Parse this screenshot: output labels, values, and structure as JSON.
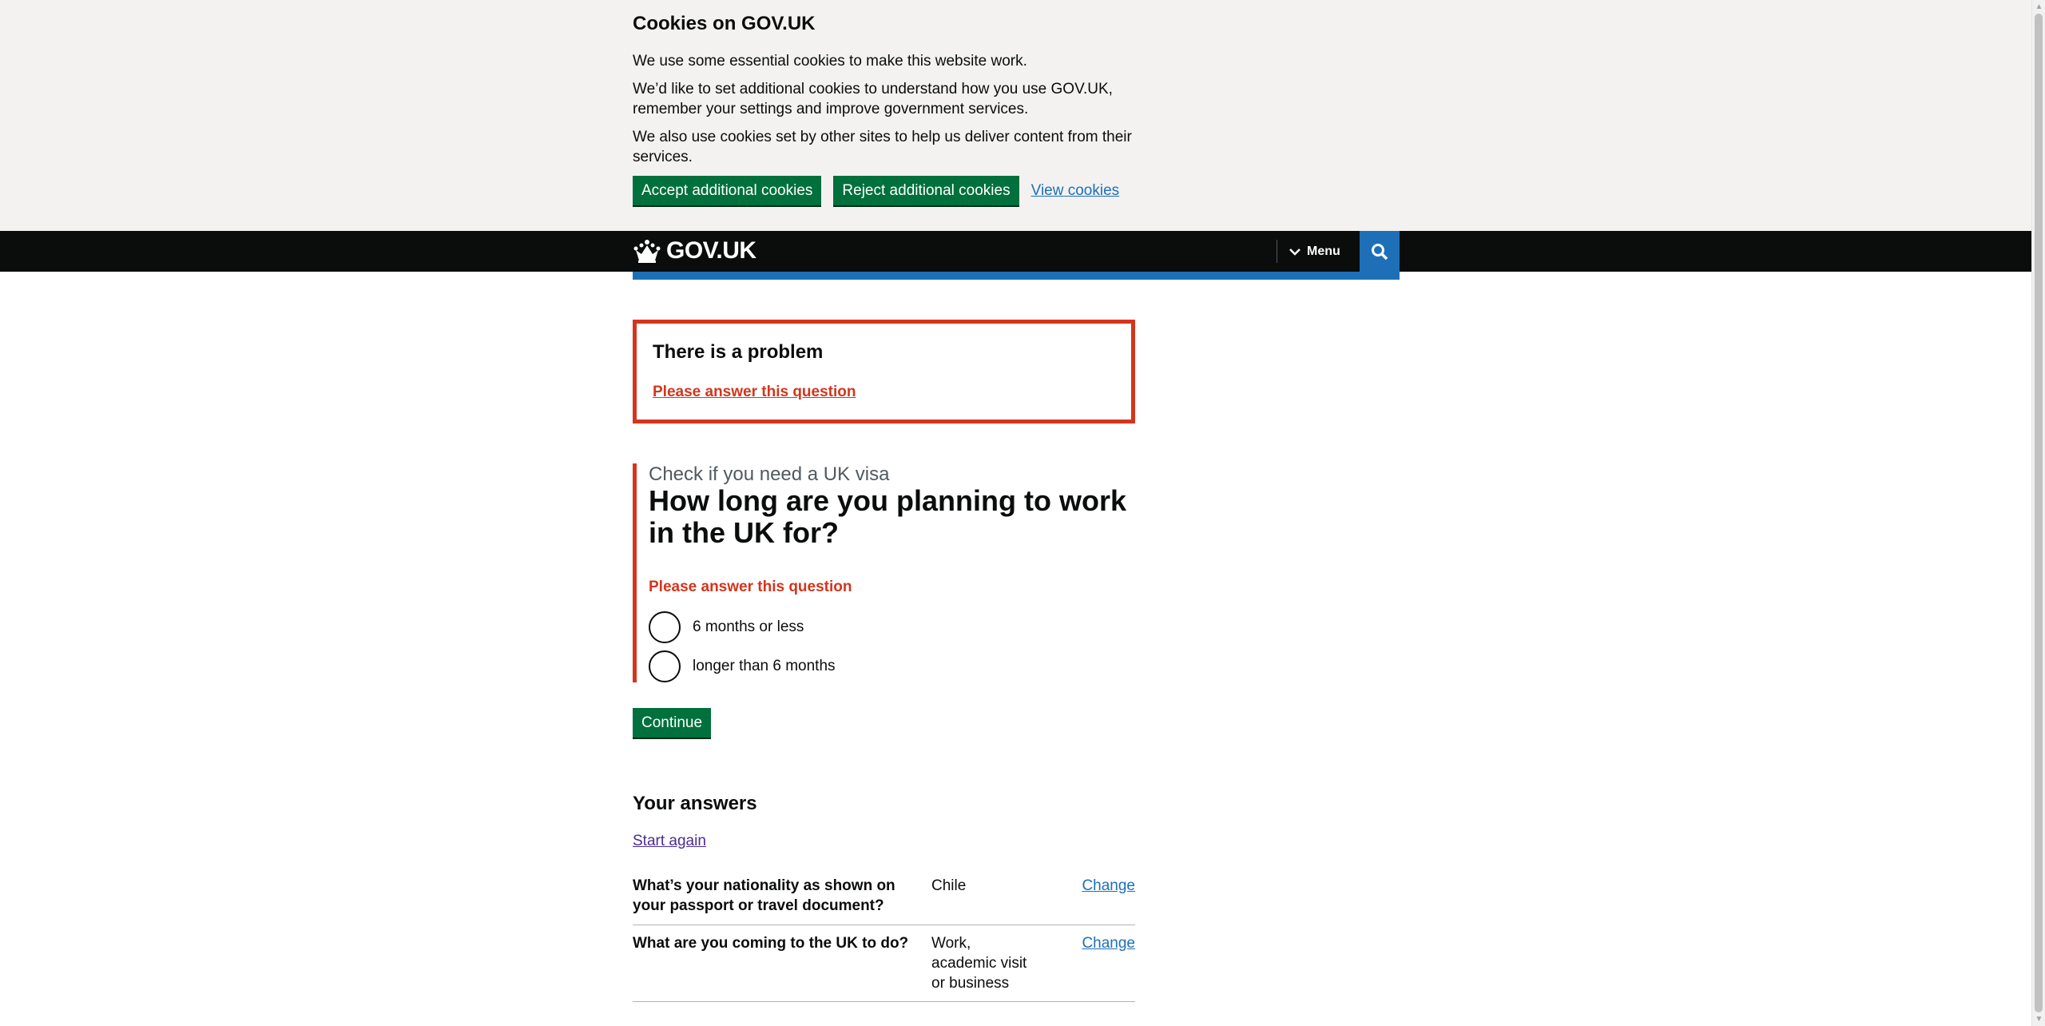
{
  "cookie_banner": {
    "title": "Cookies on GOV.UK",
    "paragraphs": [
      "We use some essential cookies to make this website work.",
      "We’d like to set additional cookies to understand how you use GOV.UK, remember your settings and improve government services.",
      "We also use cookies set by other sites to help us deliver content from their services."
    ],
    "accept_label": "Accept additional cookies",
    "reject_label": "Reject additional cookies",
    "view_label": "View cookies"
  },
  "header": {
    "logo_text": "GOV.UK",
    "menu_label": "Menu"
  },
  "error_summary": {
    "title": "There is a problem",
    "link": "Please answer this question"
  },
  "question": {
    "caption": "Check if you need a UK visa",
    "heading": "How long are you planning to work in the UK for?",
    "error": "Please answer this question",
    "options": [
      "6 months or less",
      "longer than 6 months"
    ]
  },
  "continue_label": "Continue",
  "answers": {
    "title": "Your answers",
    "start_again": "Start again",
    "rows": [
      {
        "question": "What’s your nationality as shown on your passport or travel document?",
        "answer": "Chile",
        "change": "Change"
      },
      {
        "question": "What are you coming to the UK to do?",
        "answer": "Work, academic visit or business",
        "change": "Change"
      }
    ]
  },
  "colors": {
    "brand_blue": "#1d70b8",
    "button_green": "#00703c",
    "error_red": "#d4351c",
    "header_black": "#0b0c0c"
  }
}
